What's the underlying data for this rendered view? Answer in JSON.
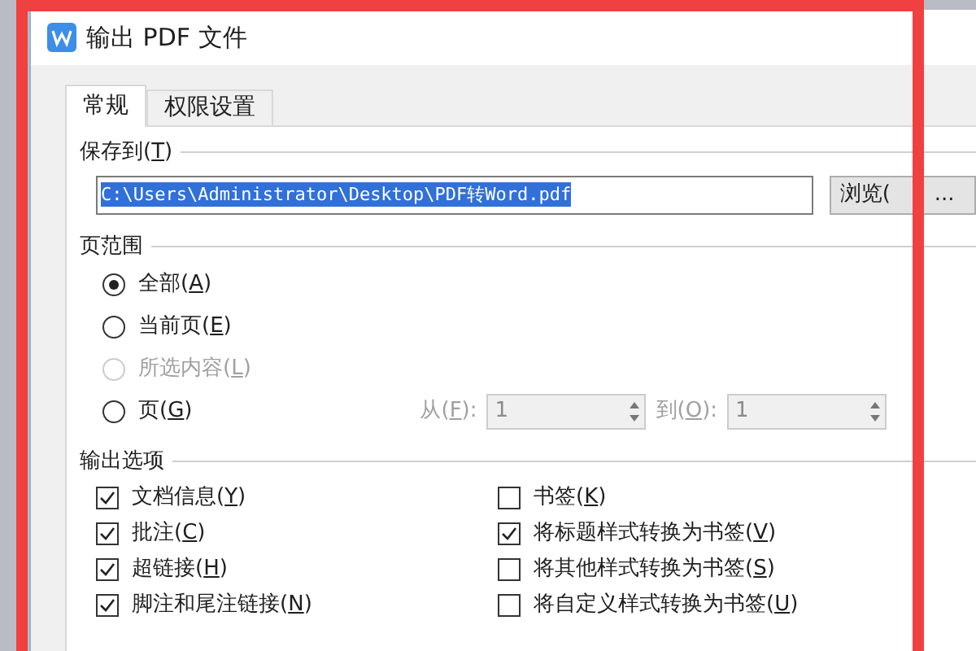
{
  "window": {
    "title": "输出 PDF 文件"
  },
  "tabs": [
    {
      "label": "常规",
      "selected": true
    },
    {
      "label": "权限设置",
      "selected": false
    }
  ],
  "save_to": {
    "label": "保存到(T)",
    "value": "C:\\Users\\Administrator\\Desktop\\PDF转Word.pdf",
    "browse_button": {
      "label": "浏览(",
      "trailing": "..."
    }
  },
  "page_range": {
    "label": "页范围",
    "options": [
      {
        "label": "全部(A)",
        "selected": true,
        "disabled": false
      },
      {
        "label": "当前页(E)",
        "selected": false,
        "disabled": false
      },
      {
        "label": "所选内容(L)",
        "selected": false,
        "disabled": true
      },
      {
        "label": "页(G)",
        "selected": false,
        "disabled": false
      }
    ],
    "from": {
      "label": "从(F):",
      "value": "1"
    },
    "to": {
      "label": "到(O):",
      "value": "1"
    }
  },
  "output_options": {
    "label": "输出选项",
    "left": [
      {
        "label": "文档信息(Y)",
        "checked": true
      },
      {
        "label": "批注(C)",
        "checked": true
      },
      {
        "label": "超链接(H)",
        "checked": true
      },
      {
        "label": "脚注和尾注链接(N)",
        "checked": true
      }
    ],
    "right": [
      {
        "label": "书签(K)",
        "checked": false
      },
      {
        "label": "将标题样式转换为书签(V)",
        "checked": true
      },
      {
        "label": "将其他样式转换为书签(S)",
        "checked": false
      },
      {
        "label": "将自定义样式转换为书签(U)",
        "checked": false
      }
    ]
  }
}
